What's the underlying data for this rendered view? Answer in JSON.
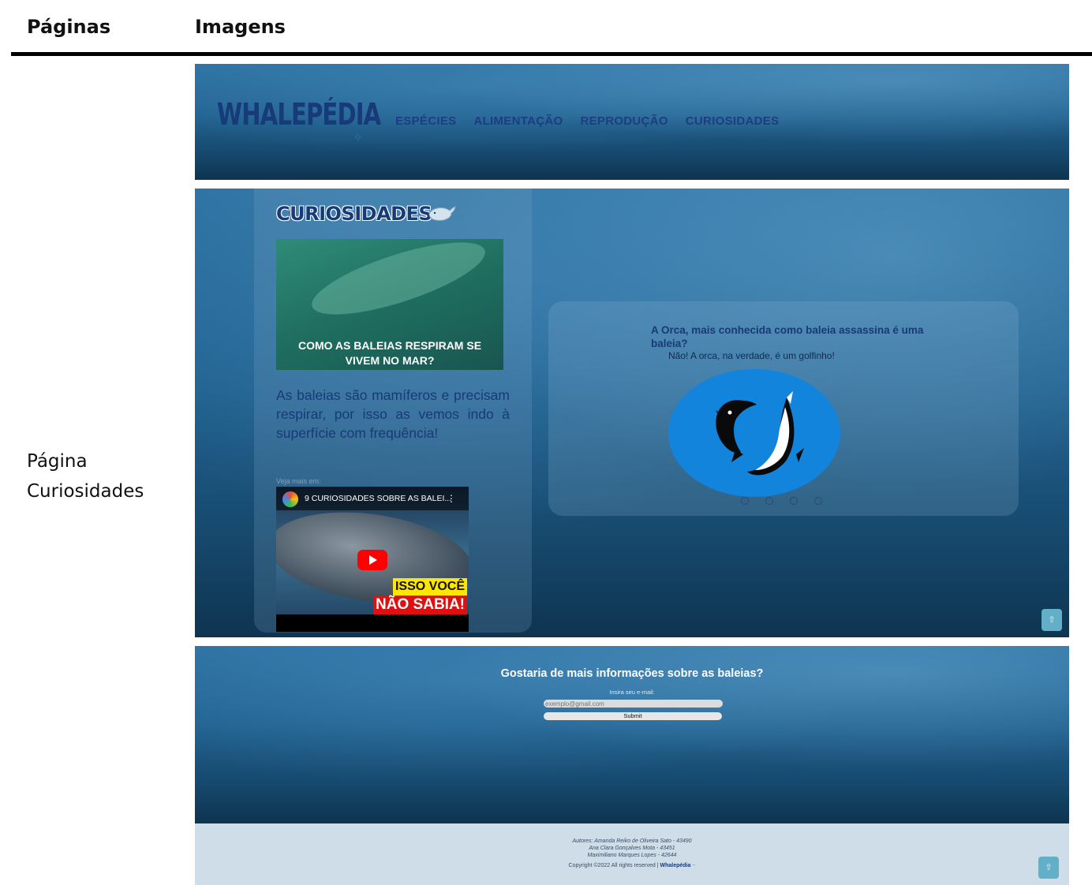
{
  "doc": {
    "col_pages": "Páginas",
    "col_images": "Imagens",
    "row_label_line1": "Página",
    "row_label_line2": "Curiosidades"
  },
  "navbar": {
    "logo": "WHALEPÉDIA",
    "links": [
      "ESPÉCIES",
      "ALIMENTAÇÃO",
      "REPRODUÇÃO",
      "CURIOSIDADES"
    ]
  },
  "curiosities": {
    "title": "CURIOSIDADES",
    "title_icon": "whale-icon",
    "image_caption": "COMO AS BALEIAS RESPIRAM SE VIVEM NO MAR?",
    "text": "As baleias são mamíferos e precisam respirar, por isso as vemos indo à superfície com frequência!",
    "see_more": "Veja mais em:",
    "video": {
      "title": "9 CURIOSIDADES SOBRE AS BALEI...",
      "banner_line1": "ISSO VOCÊ",
      "banner_line2": "NÃO SABIA!"
    },
    "carousel": {
      "question": "A Orca, mais conhecida como baleia assassina é uma baleia?",
      "answer": "Não! A orca, na verdade, é um golfinho!",
      "dots": 4,
      "active_dot": 0
    },
    "scroll_top_icon": "arrow-up-icon"
  },
  "newsletter": {
    "title": "Gostaria de mais informações sobre as baleias?",
    "email_label": "Insira seu e-mail:",
    "email_placeholder": "exemplo@gmail.com",
    "submit_label": "Submit"
  },
  "footer": {
    "authors_line1": "Autores: Amanda Reiko de Oliveira Sato - 43490",
    "authors_line2": "Ana Clara Gonçalves Mota - 43451",
    "authors_line3": "Maximiliano Marques Lopes - 42644",
    "copyright": "Copyright ©2022 All rights reserved |",
    "brand": "Whalepédia"
  },
  "colors": {
    "ocean": "#1f5f8d",
    "brand_navy": "#173a78",
    "footer_bg": "#cfdde8",
    "scroll_button": "#62b0c8",
    "orca_circle": "#1384dc"
  }
}
